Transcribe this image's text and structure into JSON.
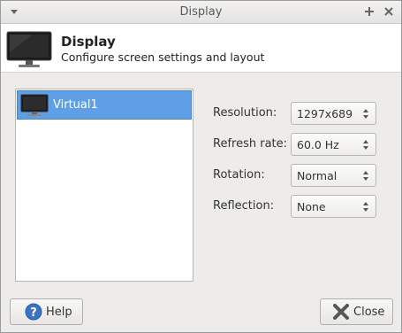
{
  "window": {
    "title": "Display"
  },
  "header": {
    "title": "Display",
    "subtitle": "Configure screen settings and layout",
    "icon": "monitor-icon"
  },
  "displays": [
    {
      "label": "Virtual1",
      "selected": true,
      "icon": "monitor-icon"
    }
  ],
  "settings": {
    "resolution": {
      "label": "Resolution:",
      "value": "1297x689"
    },
    "refresh_rate": {
      "label": "Refresh rate:",
      "value": "60.0 Hz"
    },
    "rotation": {
      "label": "Rotation:",
      "value": "Normal"
    },
    "reflection": {
      "label": "Reflection:",
      "value": "None"
    }
  },
  "buttons": {
    "help": {
      "label": "Help",
      "icon": "help-icon"
    },
    "close": {
      "label": "Close",
      "icon": "close-x-icon"
    }
  },
  "colors": {
    "selection": "#5e9fe5",
    "help_icon": "#3b73c4",
    "close_icon": "#555753"
  }
}
